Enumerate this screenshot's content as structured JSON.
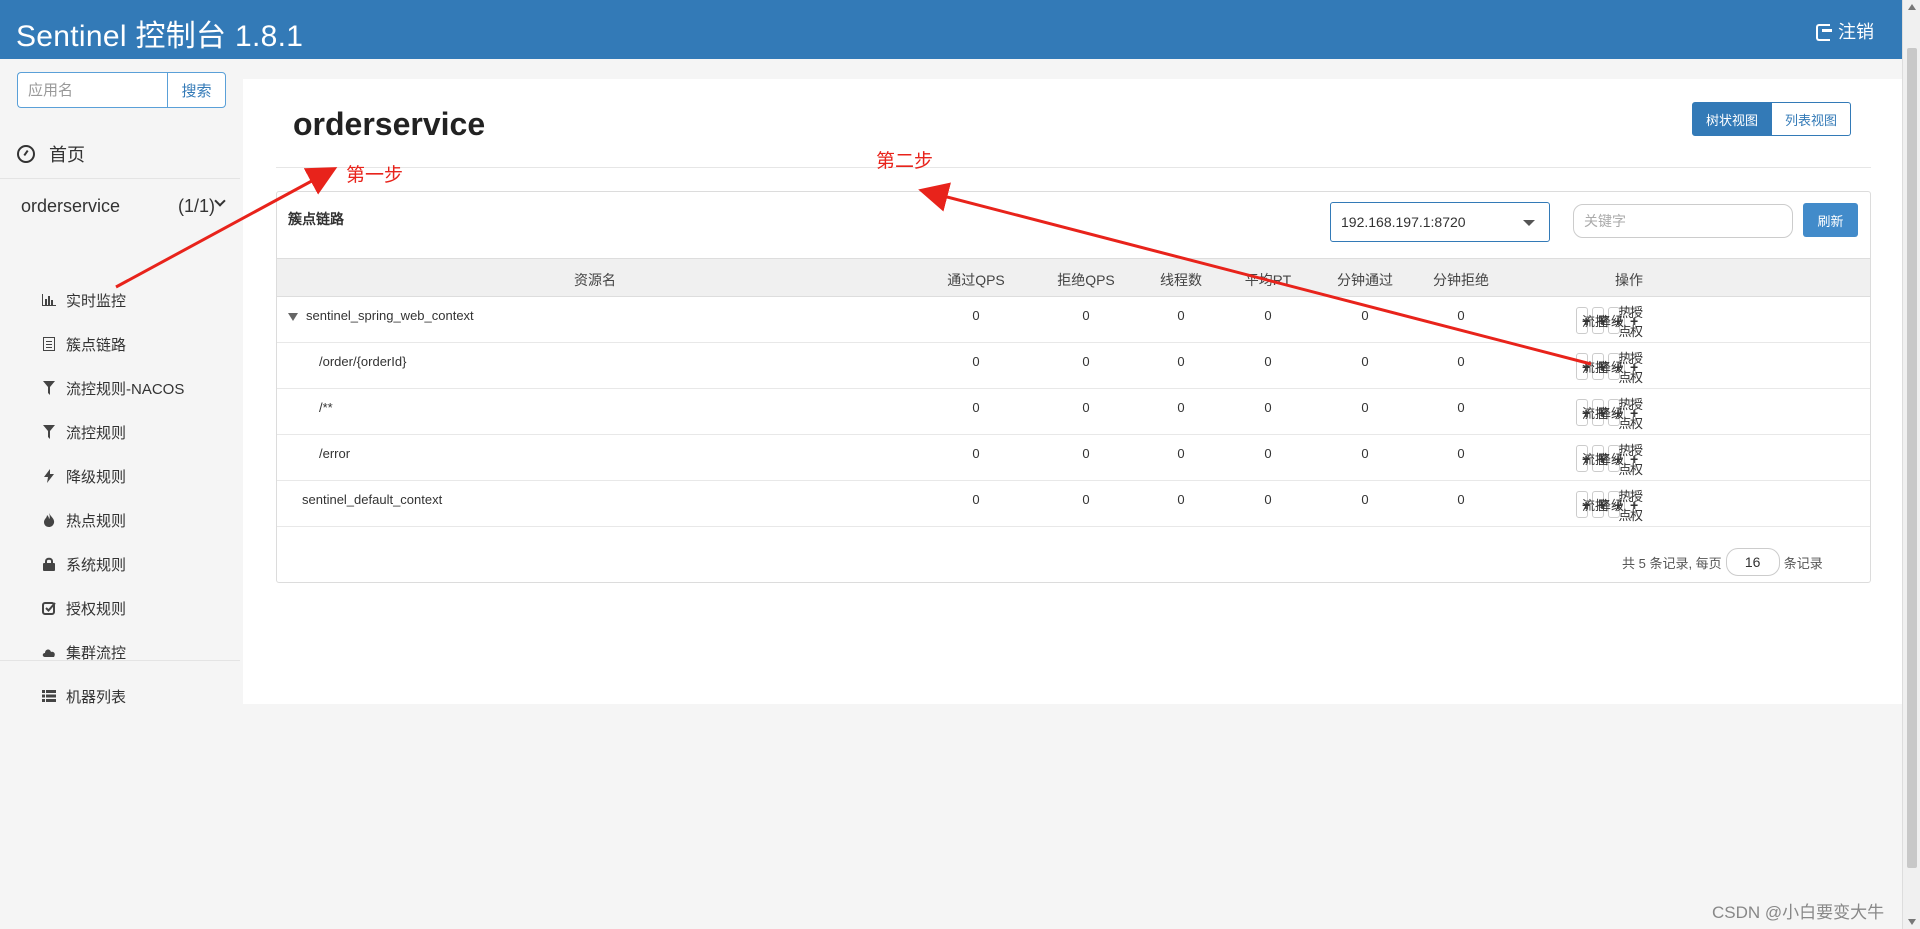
{
  "header": {
    "title": "Sentinel 控制台 1.8.1",
    "logout_label": "注销"
  },
  "sidebar": {
    "search": {
      "placeholder": "应用名",
      "button_label": "搜索"
    },
    "home_label": "首页",
    "app": {
      "name": "orderservice",
      "count": "(1/1)"
    },
    "items": [
      {
        "label": "实时监控",
        "icon": "bar-chart-icon"
      },
      {
        "label": "簇点链路",
        "icon": "list-icon"
      },
      {
        "label": "流控规则-NACOS",
        "icon": "filter-icon"
      },
      {
        "label": "流控规则",
        "icon": "filter-icon"
      },
      {
        "label": "降级规则",
        "icon": "flash-icon"
      },
      {
        "label": "热点规则",
        "icon": "fire-icon"
      },
      {
        "label": "系统规则",
        "icon": "lock-icon"
      },
      {
        "label": "授权规则",
        "icon": "check-icon"
      },
      {
        "label": "集群流控",
        "icon": "cloud-icon"
      },
      {
        "label": "机器列表",
        "icon": "table-icon"
      }
    ]
  },
  "main": {
    "title": "orderservice",
    "view_toggle": {
      "tree_label": "树状视图",
      "list_label": "列表视图"
    },
    "card_title": "簇点链路",
    "machine_select": "192.168.197.1:8720",
    "keyword_placeholder": "关键字",
    "refresh_label": "刷新",
    "columns": [
      "资源名",
      "通过QPS",
      "拒绝QPS",
      "线程数",
      "平均RT",
      "分钟通过",
      "分钟拒绝",
      "操作"
    ],
    "rows": [
      {
        "resource": "sentinel_spring_web_context",
        "pass_qps": "0",
        "block_qps": "0",
        "threads": "0",
        "avg_rt": "0",
        "minute_pass": "0",
        "minute_block": "0"
      },
      {
        "resource": "/order/{orderId}",
        "pass_qps": "0",
        "block_qps": "0",
        "threads": "0",
        "avg_rt": "0",
        "minute_pass": "0",
        "minute_block": "0"
      },
      {
        "resource": "/**",
        "pass_qps": "0",
        "block_qps": "0",
        "threads": "0",
        "avg_rt": "0",
        "minute_pass": "0",
        "minute_block": "0"
      },
      {
        "resource": "/error",
        "pass_qps": "0",
        "block_qps": "0",
        "threads": "0",
        "avg_rt": "0",
        "minute_pass": "0",
        "minute_block": "0"
      },
      {
        "resource": "sentinel_default_context",
        "pass_qps": "0",
        "block_qps": "0",
        "threads": "0",
        "avg_rt": "0",
        "minute_pass": "0",
        "minute_block": "0"
      }
    ],
    "op_buttons": {
      "flow": "流控",
      "degrade": "降级",
      "hotspot": "热点",
      "authority": "授权"
    },
    "pager": {
      "prefix": "共 5 条记录, 每页",
      "page_size": "16",
      "suffix": "条记录"
    }
  },
  "annotations": {
    "step1": "第一步",
    "step2": "第二步",
    "arrow_color": "#e8231b"
  },
  "watermark": "CSDN @小白要变大牛",
  "colors": {
    "primary": "#337ab7",
    "button_blue": "#428bca"
  }
}
